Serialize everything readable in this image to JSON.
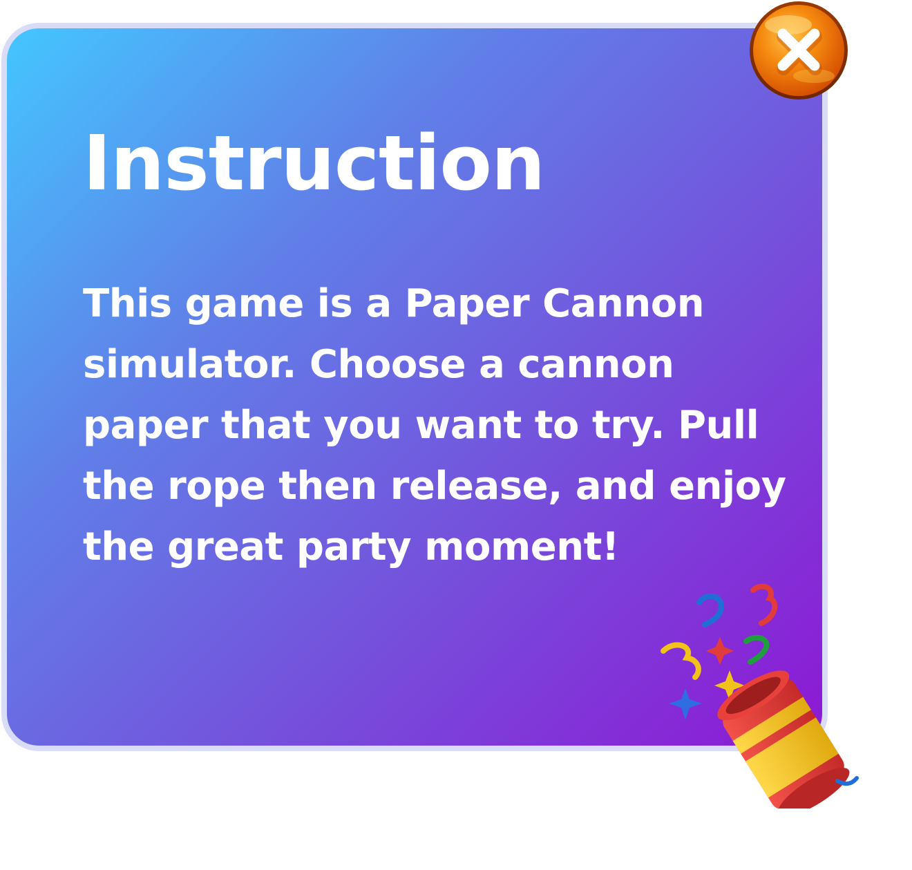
{
  "dialog": {
    "title": "Instruction",
    "body": "This game is a Paper Cannon simulator. Choose a cannon paper that you want to try. Pull the rope then release, and enjoy the great party moment!",
    "close_icon": "close-icon",
    "decoration_icon": "party-popper-icon"
  },
  "colors": {
    "gradient_start": "#44c6ff",
    "gradient_end": "#8d18d4",
    "panel_border": "#d8dcf6",
    "close_button": "#f07a10",
    "text": "#ffffff"
  }
}
